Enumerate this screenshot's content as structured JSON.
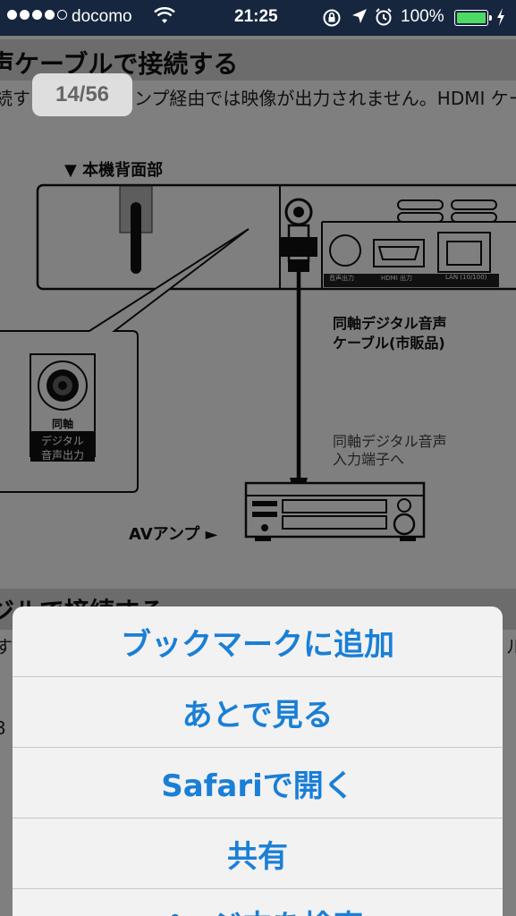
{
  "status_bar": {
    "carrier": "docomo",
    "time": "21:25",
    "battery_percent": "100%",
    "battery_level": 1.0
  },
  "page": {
    "section1_title": "声ケーブルで接続する",
    "section1_text": "続す",
    "section1_text_right": "ンプ経由では映像が出力されません。HDMI ケーブル",
    "page_indicator": "14/56",
    "diagram": {
      "rear_label": "▼ 本機背面部",
      "port_label_audio": "音声出力",
      "port_label_hdmi": "HDMI 出力",
      "port_label_lan": "LAN (10/100)",
      "zoom_label_coax": "同軸",
      "zoom_label_digital": "デジタル",
      "zoom_label_audio_out": "音声出力",
      "cable_label_1": "同軸デジタル音声",
      "cable_label_2": "ケーブル(市販品)",
      "input_label_1": "同軸デジタル音声",
      "input_label_2": "入力端子へ",
      "amp_label": "AVアンプ ►"
    },
    "section2_title": "ジルで接続する",
    "section2_text_left": "す",
    "section2_text_right": "ル",
    "section2_text_left2": "3"
  },
  "action_sheet": {
    "items": [
      "ブックマークに追加",
      "あとで見る",
      "Safariで開く",
      "共有",
      "ページ内を検索"
    ]
  }
}
